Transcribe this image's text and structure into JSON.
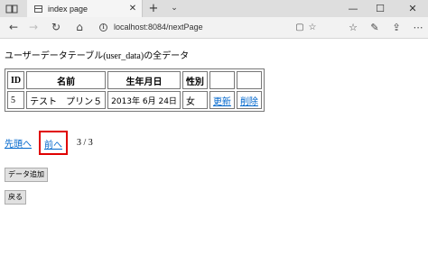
{
  "browser": {
    "tab_title": "index page",
    "tab_close": "✕",
    "new_tab": "+",
    "tab_dropdown": "⌄",
    "minimize": "—",
    "maximize": "☐",
    "close": "✕",
    "url": "localhost:8084/nextPage",
    "icons": {
      "back": "←",
      "forward": "→",
      "refresh": "↻",
      "home": "⌂",
      "info": "i",
      "reading": "▢",
      "favorite": "☆",
      "favorites_hub": "☆",
      "notes": "✎",
      "share": "⇪",
      "more": "⋯"
    }
  },
  "page": {
    "heading_main": "ユーザーデータテーブル",
    "heading_sub": "(user_data)",
    "heading_tail": "の全データ",
    "table": {
      "headers": [
        "ID",
        "名前",
        "生年月日",
        "性別",
        "",
        ""
      ],
      "rows": [
        {
          "id": "5",
          "name": "テスト　プリン５",
          "birth": "2013年 6月 24日",
          "sex": "女",
          "update_label": "更新",
          "delete_label": "削除"
        }
      ]
    },
    "pager": {
      "first_label": "先頭へ",
      "prev_label": "前へ",
      "page_info": "3 / 3"
    },
    "buttons": {
      "add_label": "データ追加",
      "back_label": "戻る"
    }
  }
}
